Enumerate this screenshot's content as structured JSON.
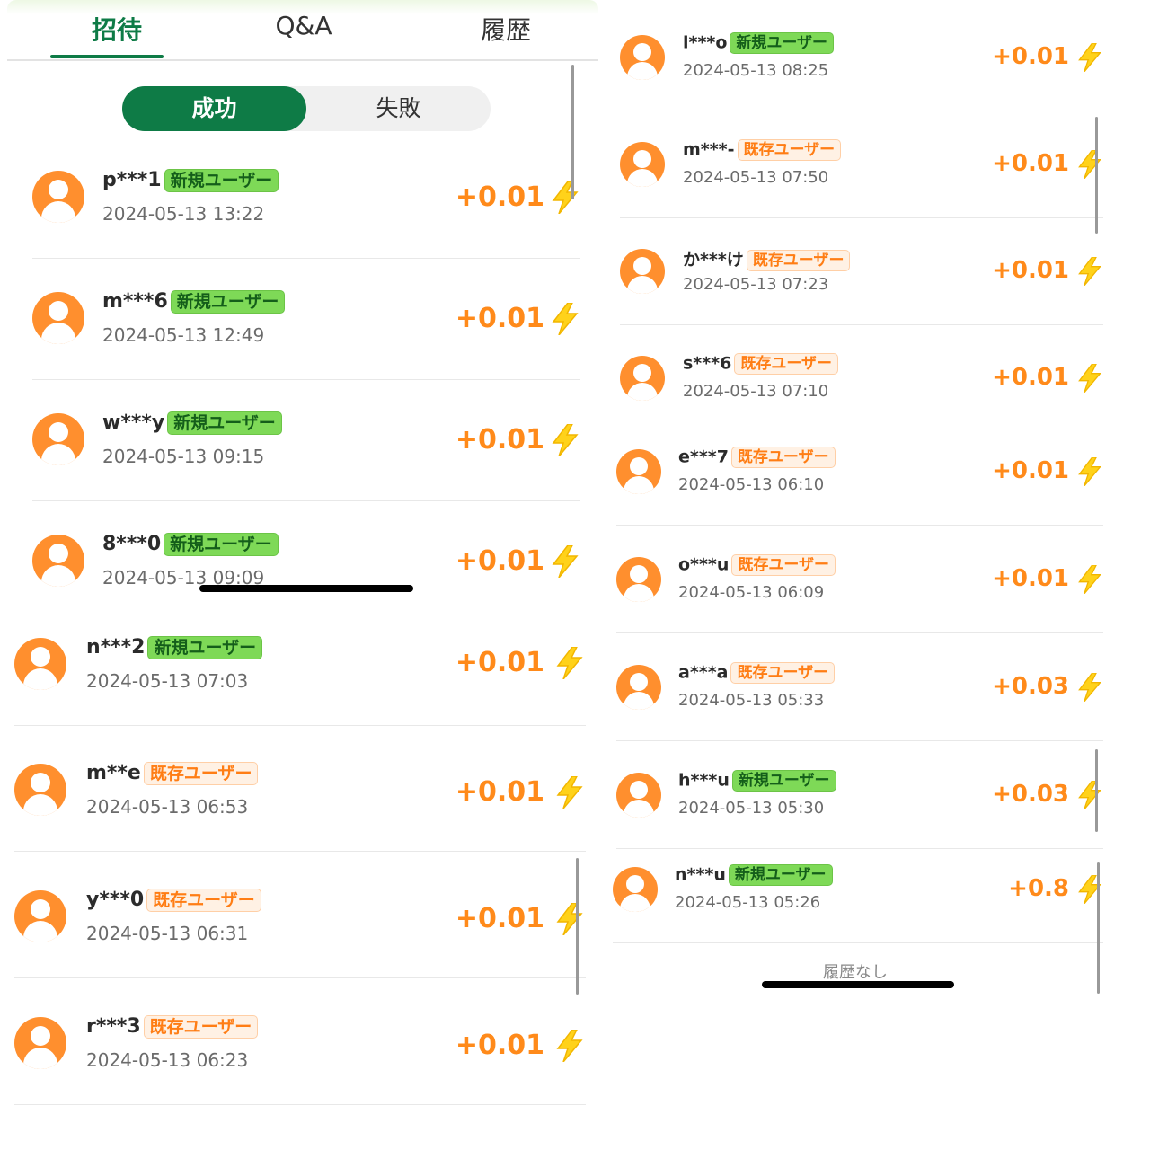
{
  "tabs": [
    {
      "label": "招待",
      "active": true
    },
    {
      "label": "Q&A",
      "active": false
    },
    {
      "label": "履歴",
      "active": false
    }
  ],
  "segment": {
    "success": "成功",
    "failure": "失敗"
  },
  "colors": {
    "brand": "#0e7b46",
    "amount": "#ff8a1a",
    "new_badge": "#7ed957",
    "existing_badge": "#fff1e4",
    "avatar": "#ff8f2e"
  },
  "left_list": [
    {
      "user": "p***1",
      "badge": "新規ユーザー",
      "badge_type": "new",
      "time": "2024-05-13 13:22",
      "amount": "+0.01"
    },
    {
      "user": "m***6",
      "badge": "新規ユーザー",
      "badge_type": "new",
      "time": "2024-05-13 12:49",
      "amount": "+0.01"
    },
    {
      "user": "w***y",
      "badge": "新規ユーザー",
      "badge_type": "new",
      "time": "2024-05-13 09:15",
      "amount": "+0.01"
    },
    {
      "user": "8***0",
      "badge": "新規ユーザー",
      "badge_type": "new",
      "time": "2024-05-13 09:09",
      "amount": "+0.01"
    },
    {
      "user": "n***2",
      "badge": "新規ユーザー",
      "badge_type": "new",
      "time": "2024-05-13 07:03",
      "amount": "+0.01"
    },
    {
      "user": "m**e",
      "badge": "既存ユーザー",
      "badge_type": "old",
      "time": "2024-05-13 06:53",
      "amount": "+0.01"
    },
    {
      "user": "y***0",
      "badge": "既存ユーザー",
      "badge_type": "old",
      "time": "2024-05-13 06:31",
      "amount": "+0.01"
    },
    {
      "user": "r***3",
      "badge": "既存ユーザー",
      "badge_type": "old",
      "time": "2024-05-13 06:23",
      "amount": "+0.01"
    }
  ],
  "right_list": [
    {
      "user": "l***o",
      "badge": "新規ユーザー",
      "badge_type": "new",
      "time": "2024-05-13 08:25",
      "amount": "+0.01"
    },
    {
      "user": "m***-",
      "badge": "既存ユーザー",
      "badge_type": "old",
      "time": "2024-05-13 07:50",
      "amount": "+0.01"
    },
    {
      "user": "か***け",
      "badge": "既存ユーザー",
      "badge_type": "old",
      "time": "2024-05-13 07:23",
      "amount": "+0.01"
    },
    {
      "user": "s***6",
      "badge": "既存ユーザー",
      "badge_type": "old",
      "time": "2024-05-13 07:10",
      "amount": "+0.01"
    },
    {
      "user": "e***7",
      "badge": "既存ユーザー",
      "badge_type": "old",
      "time": "2024-05-13 06:10",
      "amount": "+0.01"
    },
    {
      "user": "o***u",
      "badge": "既存ユーザー",
      "badge_type": "old",
      "time": "2024-05-13 06:09",
      "amount": "+0.01"
    },
    {
      "user": "a***a",
      "badge": "既存ユーザー",
      "badge_type": "old",
      "time": "2024-05-13 05:33",
      "amount": "+0.03"
    },
    {
      "user": "h***u",
      "badge": "新規ユーザー",
      "badge_type": "new",
      "time": "2024-05-13 05:30",
      "amount": "+0.03"
    },
    {
      "user": "n***u",
      "badge": "新規ユーザー",
      "badge_type": "new",
      "time": "2024-05-13 05:26",
      "amount": "+0.8"
    }
  ],
  "empty_note": "履歴なし"
}
